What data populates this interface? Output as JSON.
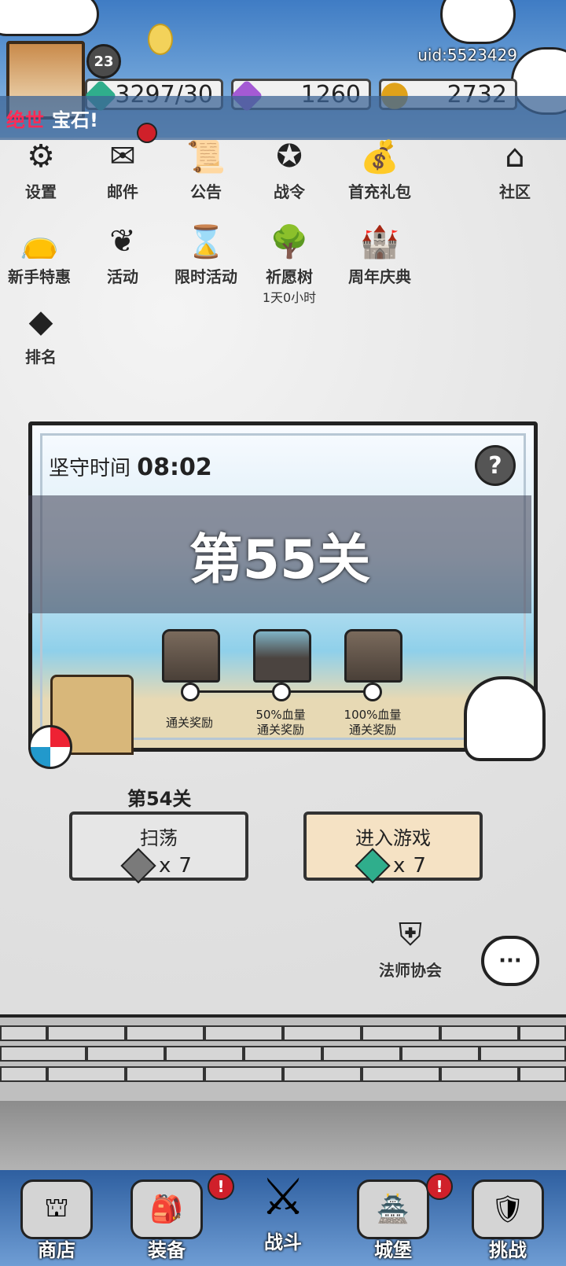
{
  "header": {
    "level": "23",
    "uid": "uid:5523429",
    "resources": [
      {
        "icon": "green-gem-icon",
        "value": "3297/30",
        "color": "#2fae8c"
      },
      {
        "icon": "purple-gem-icon",
        "value": "1260",
        "color": "#a45ad4"
      },
      {
        "icon": "gold-coin-icon",
        "value": "2732",
        "color": "#e0a21a"
      }
    ]
  },
  "banner": {
    "highlight": "绝世",
    "text": "宝石!"
  },
  "menu": [
    {
      "label": "设置",
      "icon": "gear-icon"
    },
    {
      "label": "邮件",
      "icon": "mail-icon"
    },
    {
      "label": "公告",
      "icon": "scroll-icon"
    },
    {
      "label": "战令",
      "icon": "battle-pass-icon"
    },
    {
      "label": "首充礼包",
      "icon": "gift-bag-icon"
    },
    {
      "label": "社区",
      "icon": "home-icon"
    },
    {
      "label": "新手特惠",
      "icon": "money-bag-icon"
    },
    {
      "label": "活动",
      "icon": "laurel-icon"
    },
    {
      "label": "限时活动",
      "icon": "hourglass-icon"
    },
    {
      "label": "祈愿树",
      "sub": "1天0小时",
      "icon": "tree-icon"
    },
    {
      "label": "周年庆典",
      "icon": "castle-icon"
    },
    {
      "label": "排名",
      "icon": "podium-icon"
    }
  ],
  "panel": {
    "timer_label": "坚守时间",
    "timer_value": "08:02",
    "stage_title": "第55关",
    "rewards": [
      {
        "line1": "通关奖励",
        "line2": ""
      },
      {
        "line1": "50%血量",
        "line2": "通关奖励"
      },
      {
        "line1": "100%血量",
        "line2": "通关奖励"
      }
    ]
  },
  "prev_stage": "第54关",
  "buttons": {
    "sweep": {
      "label": "扫荡",
      "cost": "7",
      "symbol": "x"
    },
    "enter": {
      "label": "进入游戏",
      "cost": "7",
      "symbol": "x"
    }
  },
  "guild": {
    "label": "法师协会"
  },
  "chat_icon": "chat-bubble-icon",
  "chat_glyph": "···",
  "nav": [
    {
      "label": "商店",
      "icon": "shop-icon"
    },
    {
      "label": "装备",
      "icon": "backpack-icon"
    },
    {
      "label": "战斗",
      "icon": "crossed-swords-icon"
    },
    {
      "label": "城堡",
      "icon": "tower-icon"
    },
    {
      "label": "挑战",
      "icon": "shield-icon"
    }
  ],
  "badge_glyph": "!",
  "help_glyph": "?"
}
